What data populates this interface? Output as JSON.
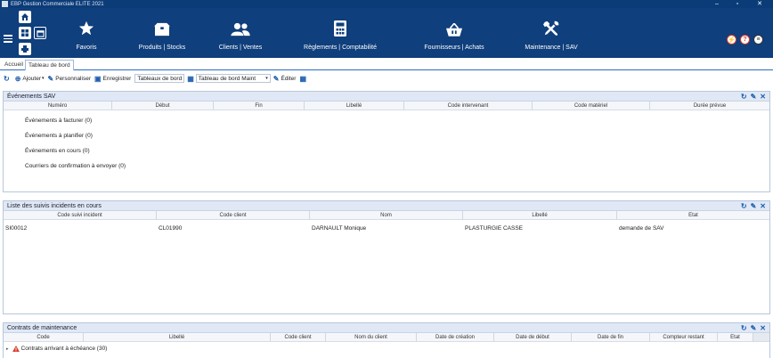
{
  "window": {
    "title": "EBP Gestion Commerciale ELITE 2021",
    "minimize": "–",
    "restore": "▫",
    "close": "✕"
  },
  "ribbon": {
    "nav": [
      {
        "label": "Favoris",
        "icon": "star-icon"
      },
      {
        "label": "Produits | Stocks",
        "icon": "boxes-icon"
      },
      {
        "label": "Clients | Ventes",
        "icon": "people-icon"
      },
      {
        "label": "Règlements | Comptabilité",
        "icon": "calculator-icon"
      },
      {
        "label": "Fournisseurs | Achats",
        "icon": "basket-icon"
      },
      {
        "label": "Maintenance | SAV",
        "icon": "tools-icon"
      }
    ],
    "right_icons": [
      "lightning-icon",
      "help-icon",
      "settings-icon"
    ]
  },
  "tabs": [
    {
      "label": "Accueil"
    },
    {
      "label": "Tableau de bord"
    }
  ],
  "toolbar": {
    "add": "Ajouter",
    "customize": "Personnaliser",
    "save": "Enregistrer",
    "board_label": "Tableaux de bord",
    "board_value": "Tableau de bord Maint",
    "edit": "Éditer"
  },
  "panels": {
    "sav": {
      "title": "Événements SAV",
      "columns": [
        "Numéro",
        "Début",
        "Fin",
        "Libellé",
        "Code intervenant",
        "Code matériel",
        "Durée prévue"
      ],
      "groups": [
        "Événements à facturer (0)",
        "Événements à planifier (0)",
        "Événements en cours (0)",
        "Courriers de confirmation à envoyer (0)"
      ]
    },
    "incidents": {
      "title": "Liste des suivis incidents en cours",
      "columns": [
        "Code suivi incident",
        "Code client",
        "Nom",
        "Libellé",
        "Etat"
      ],
      "rows": [
        [
          "SI00012",
          "CL01990",
          "DARNAULT Monique",
          "PLASTURGIE CASSE",
          "demande de SAV"
        ]
      ]
    },
    "contracts": {
      "title": "Contrats de maintenance",
      "columns": [
        "Code",
        "Libellé",
        "Code client",
        "Nom du client",
        "Date de création",
        "Date de début",
        "Date de fin",
        "Compteur restant",
        "Etat"
      ],
      "group": "Contrats arrivant à échéance (30)"
    }
  }
}
